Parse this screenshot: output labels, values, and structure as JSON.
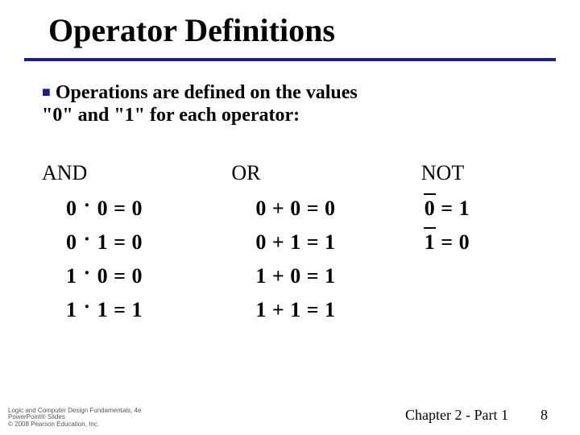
{
  "title": "Operator Definitions",
  "bullet": {
    "line1": "Operations are defined on the values",
    "line2": "\"0\" and \"1\" for each operator:"
  },
  "columns": {
    "and": {
      "header": "AND",
      "rows": [
        {
          "a": "0",
          "b": "0",
          "r": "0"
        },
        {
          "a": "0",
          "b": "1",
          "r": "0"
        },
        {
          "a": "1",
          "b": "0",
          "r": "0"
        },
        {
          "a": "1",
          "b": "1",
          "r": "1"
        }
      ]
    },
    "or": {
      "header": "OR",
      "rows": [
        {
          "a": "0",
          "b": "0",
          "r": "0"
        },
        {
          "a": "0",
          "b": "1",
          "r": "1"
        },
        {
          "a": "1",
          "b": "0",
          "r": "1"
        },
        {
          "a": "1",
          "b": "1",
          "r": "1"
        }
      ]
    },
    "not": {
      "header": "NOT",
      "rows": [
        {
          "a": "0",
          "r": "1"
        },
        {
          "a": "1",
          "r": "0"
        }
      ]
    }
  },
  "fineprint": {
    "l1": "Logic and Computer Design Fundamentals, 4e",
    "l2": "PowerPoint® Slides",
    "l3": "© 2008 Pearson Education, Inc."
  },
  "footer": {
    "chapter": "Chapter 2 - Part 1",
    "page": "8"
  }
}
